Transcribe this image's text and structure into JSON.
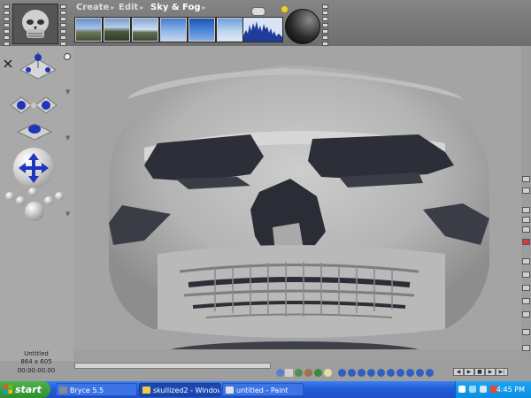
{
  "menu": {
    "create": "Create",
    "edit": "Edit",
    "sky_fog": "Sky & Fog"
  },
  "presets": [
    "sky-preset-1",
    "sky-preset-2",
    "sky-preset-3",
    "sky-preset-4",
    "sky-preset-5",
    "sky-preset-6",
    "sky-preset-7"
  ],
  "document": {
    "title": "Untitled",
    "size": "864 x 605",
    "time": "00:00:00.00"
  },
  "taskbar": {
    "start": "start",
    "tasks": [
      {
        "label": "Bryce 5.5",
        "icon": "bryce-icon",
        "active": false
      },
      {
        "label": "skullized2 - Windows ...",
        "icon": "windows-explorer-icon",
        "active": true
      },
      {
        "label": "untitled - Paint",
        "icon": "paint-icon",
        "active": false
      }
    ],
    "clock": "4:45 PM"
  },
  "colors": {
    "taskbar": "#245edb",
    "start": "#3c9a3c",
    "tray": "#0f98e8",
    "accent_blue": "#2035b8"
  },
  "icons": {
    "skull_nano_preview": "skull-preview-icon",
    "zoom": "zoom-icon",
    "render": "render-sphere-icon"
  }
}
